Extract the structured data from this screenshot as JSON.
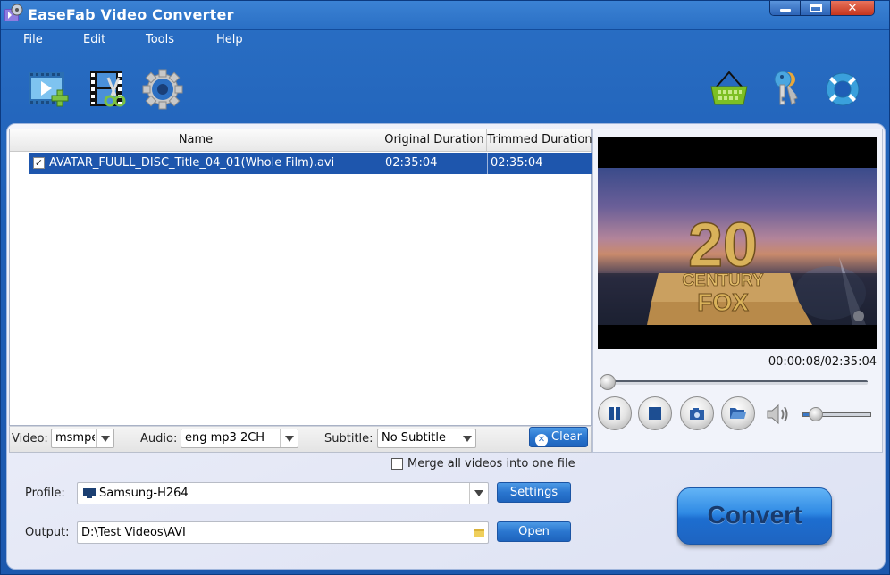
{
  "window": {
    "title": "EaseFab Video Converter",
    "controls": {
      "minimize": "minimize",
      "maximize": "maximize",
      "close": "close"
    }
  },
  "menu": [
    {
      "label": "File"
    },
    {
      "label": "Edit"
    },
    {
      "label": "Tools"
    },
    {
      "label": "Help"
    }
  ],
  "toolbar": {
    "left": [
      {
        "name": "add-video",
        "icon": "add-video-icon"
      },
      {
        "name": "edit-video",
        "icon": "video-edit-scissors-icon"
      },
      {
        "name": "options",
        "icon": "gear-icon"
      }
    ],
    "right": [
      {
        "name": "buy",
        "icon": "shopping-basket-icon"
      },
      {
        "name": "register",
        "icon": "keys-icon"
      },
      {
        "name": "help",
        "icon": "lifebuoy-icon"
      }
    ]
  },
  "file_list": {
    "columns": [
      "Name",
      "Original Duration",
      "Trimmed Duration"
    ],
    "rows": [
      {
        "checked": true,
        "name": "AVATAR_FUULL_DISC_Title_04_01(Whole Film).avi",
        "original_duration": "02:35:04",
        "trimmed_duration": "02:35:04",
        "selected": true
      }
    ]
  },
  "tracks": {
    "video_label": "Video:",
    "video_value": "msmpeg",
    "audio_label": "Audio:",
    "audio_value": "eng mp3 2CH",
    "subtitle_label": "Subtitle:",
    "subtitle_value": "No Subtitle",
    "clear_label": "Clear"
  },
  "preview": {
    "scene_text_1": "20",
    "scene_text_2": "CENTURY",
    "scene_text_3": "FOX",
    "time": "00:00:08/02:35:04",
    "progress_fraction": 0.001,
    "volume_fraction": 0.2
  },
  "output": {
    "merge_label": "Merge all videos into one file",
    "merge_checked": false,
    "profile_label": "Profile:",
    "profile_value": "Samsung-H264",
    "settings_label": "Settings",
    "output_label": "Output:",
    "output_value": "D:\\Test Videos\\AVI",
    "open_label": "Open",
    "convert_label": "Convert"
  }
}
